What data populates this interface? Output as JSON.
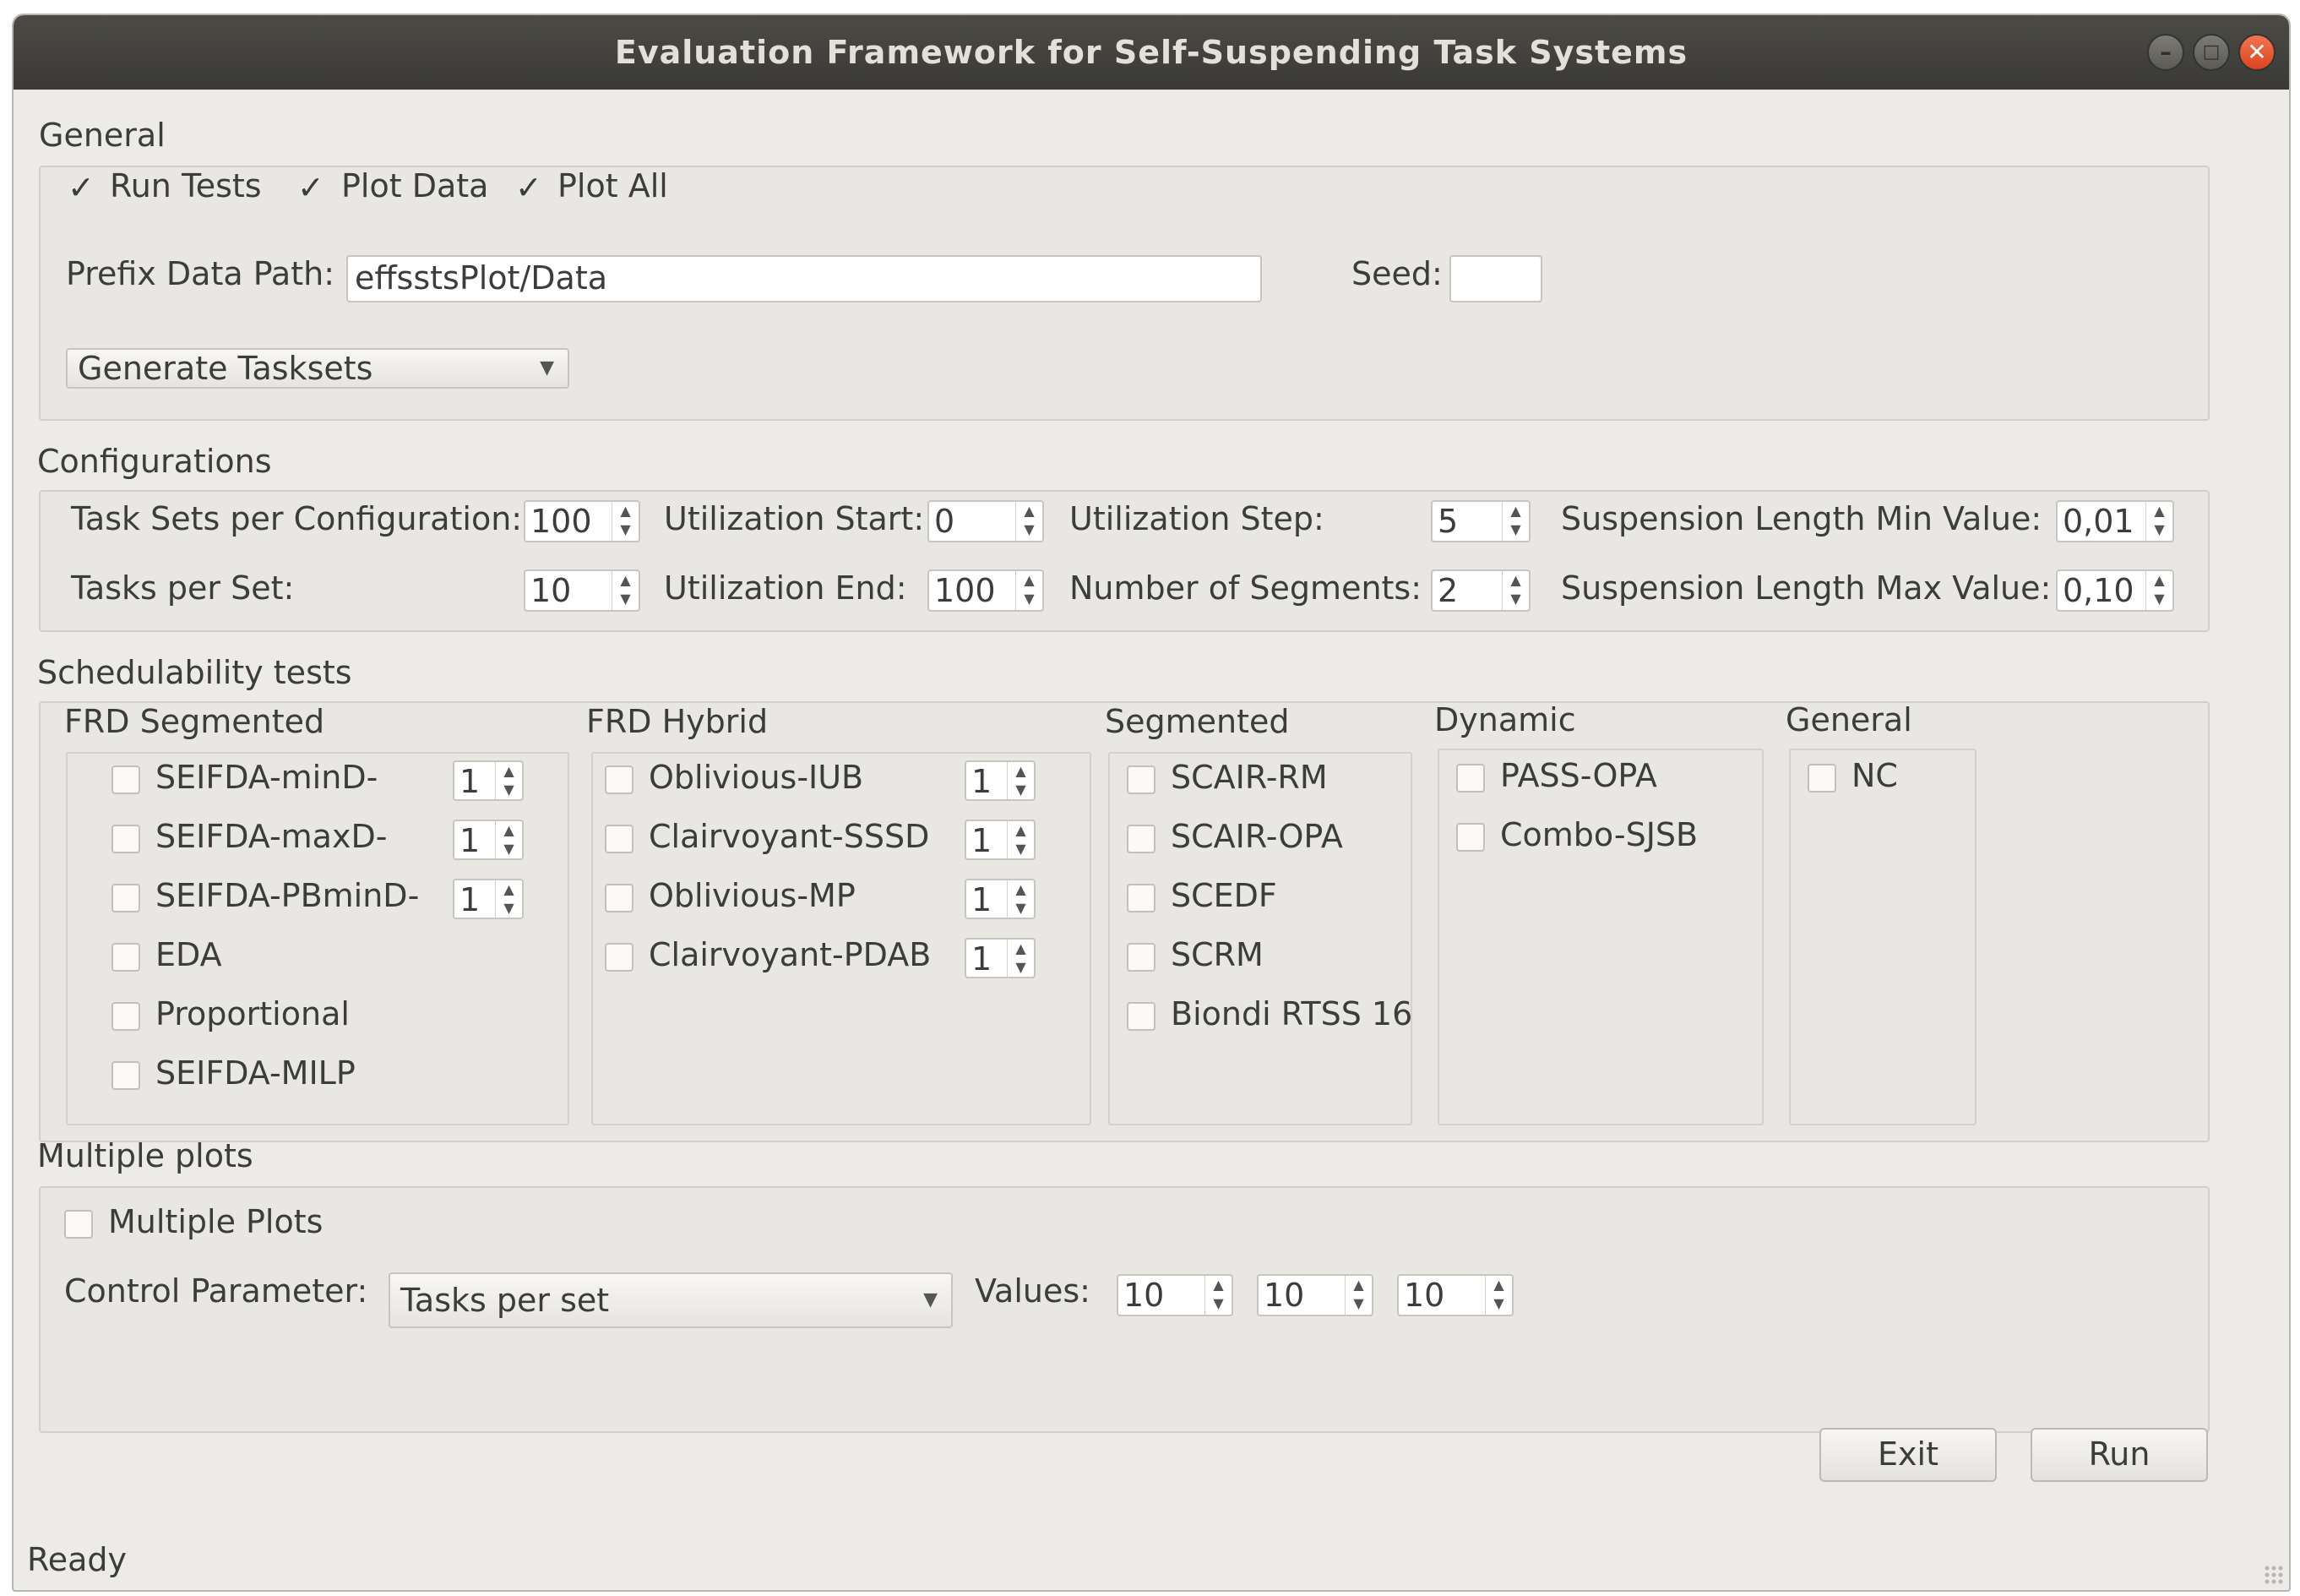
{
  "window": {
    "title": "Evaluation Framework for Self-Suspending Task Systems",
    "controls": [
      "minimize-icon",
      "maximize-icon",
      "close-icon"
    ]
  },
  "general": {
    "title": "General",
    "run_tests": {
      "label": "Run Tests",
      "checked": true
    },
    "plot_data": {
      "label": "Plot Data",
      "checked": true
    },
    "plot_all": {
      "label": "Plot All",
      "checked": true
    },
    "prefix_label": "Prefix Data Path:",
    "prefix_value": "effsstsPlot/Data",
    "seed_label": "Seed:",
    "seed_value": "",
    "mode_value": "Generate Tasksets"
  },
  "configurations": {
    "title": "Configurations",
    "task_sets_label": "Task Sets per Configuration:",
    "task_sets_value": "100",
    "tasks_per_set_label": "Tasks per Set:",
    "tasks_per_set_value": "10",
    "util_start_label": "Utilization Start:",
    "util_start_value": "0",
    "util_end_label": "Utilization End:",
    "util_end_value": "100",
    "util_step_label": "Utilization Step:",
    "util_step_value": "5",
    "segments_label": "Number of Segments:",
    "segments_value": "2",
    "susp_min_label": "Suspension Length Min Value:",
    "susp_min_value": "0,01",
    "susp_max_label": "Suspension Length Max Value:",
    "susp_max_value": "0,10"
  },
  "tests": {
    "title": "Schedulability tests",
    "frd_segmented": {
      "title": "FRD Segmented",
      "items": [
        {
          "label": "SEIFDA-minD-",
          "spin": "1"
        },
        {
          "label": "SEIFDA-maxD-",
          "spin": "1"
        },
        {
          "label": "SEIFDA-PBminD-",
          "spin": "1"
        },
        {
          "label": "EDA"
        },
        {
          "label": "Proportional"
        },
        {
          "label": "SEIFDA-MILP"
        }
      ]
    },
    "frd_hybrid": {
      "title": "FRD Hybrid",
      "items": [
        {
          "label": "Oblivious-IUB",
          "spin": "1"
        },
        {
          "label": "Clairvoyant-SSSD",
          "spin": "1"
        },
        {
          "label": "Oblivious-MP",
          "spin": "1"
        },
        {
          "label": "Clairvoyant-PDAB",
          "spin": "1"
        }
      ]
    },
    "segmented": {
      "title": "Segmented",
      "items": [
        {
          "label": "SCAIR-RM"
        },
        {
          "label": "SCAIR-OPA"
        },
        {
          "label": "SCEDF"
        },
        {
          "label": "SCRM"
        },
        {
          "label": "Biondi RTSS 16"
        }
      ]
    },
    "dynamic": {
      "title": "Dynamic",
      "items": [
        {
          "label": "PASS-OPA"
        },
        {
          "label": "Combo-SJSB"
        }
      ]
    },
    "general": {
      "title": "General",
      "items": [
        {
          "label": "NC"
        }
      ]
    }
  },
  "multiple": {
    "title": "Multiple plots",
    "checkbox_label": "Multiple Plots",
    "control_label": "Control Parameter:",
    "control_value": "Tasks per set",
    "values_label": "Values:",
    "values": [
      "10",
      "10",
      "10"
    ]
  },
  "buttons": {
    "exit": "Exit",
    "run": "Run"
  },
  "status": "Ready"
}
